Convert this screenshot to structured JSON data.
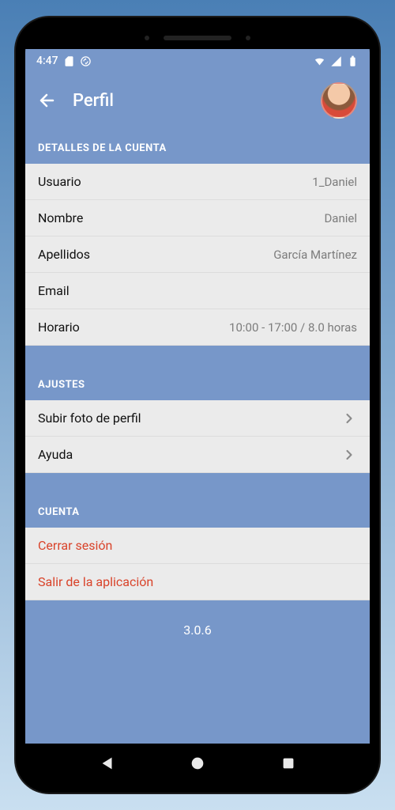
{
  "status": {
    "time": "4:47"
  },
  "header": {
    "title": "Perfil"
  },
  "sections": {
    "details": {
      "title": "DETALLES DE LA CUENTA",
      "rows": {
        "user": {
          "label": "Usuario",
          "value": "1_Daniel"
        },
        "name": {
          "label": "Nombre",
          "value": "Daniel"
        },
        "surname": {
          "label": "Apellidos",
          "value": "García Martínez"
        },
        "email": {
          "label": "Email",
          "value": ""
        },
        "schedule": {
          "label": "Horario",
          "value": "10:00 - 17:00  /  8.0 horas"
        }
      }
    },
    "settings": {
      "title": "AJUSTES",
      "rows": {
        "upload": {
          "label": "Subir foto de perfil"
        },
        "help": {
          "label": "Ayuda"
        }
      }
    },
    "account": {
      "title": "CUENTA",
      "rows": {
        "logout": {
          "label": "Cerrar sesión"
        },
        "exit": {
          "label": "Salir de la aplicación"
        }
      }
    }
  },
  "version": "3.0.6"
}
